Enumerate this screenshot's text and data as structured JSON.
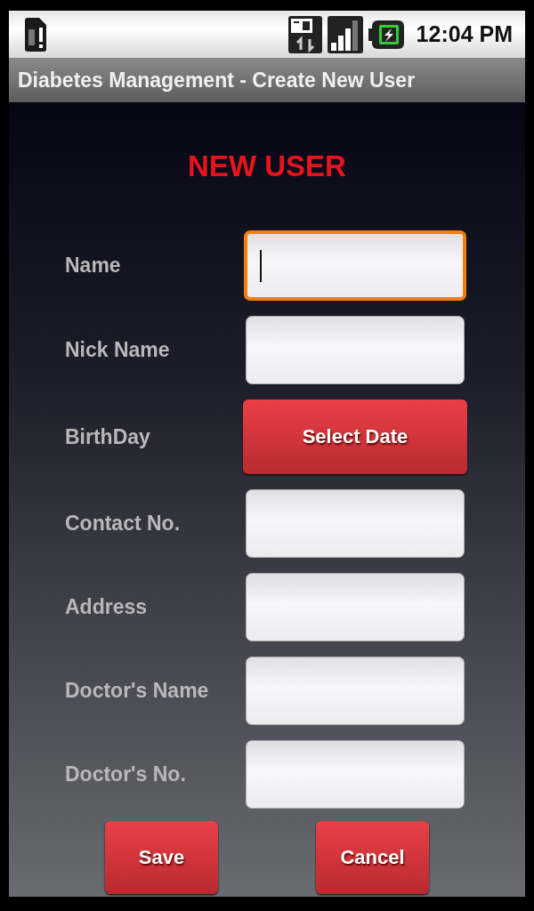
{
  "status_bar": {
    "time": "12:04 PM"
  },
  "window": {
    "title": "Diabetes Management - Create New User"
  },
  "heading": "NEW USER",
  "fields": [
    {
      "label": "Name",
      "kind": "text",
      "focused": true
    },
    {
      "label": "Nick Name",
      "kind": "text",
      "focused": false
    },
    {
      "label": "BirthDay",
      "kind": "button",
      "button_label": "Select Date"
    },
    {
      "label": "Contact No.",
      "kind": "text",
      "focused": false
    },
    {
      "label": "Address",
      "kind": "text",
      "focused": false
    },
    {
      "label": "Doctor's Name",
      "kind": "text",
      "focused": false
    },
    {
      "label": "Doctor's No.",
      "kind": "text",
      "focused": false
    }
  ],
  "buttons": [
    "Save",
    "Cancel"
  ]
}
